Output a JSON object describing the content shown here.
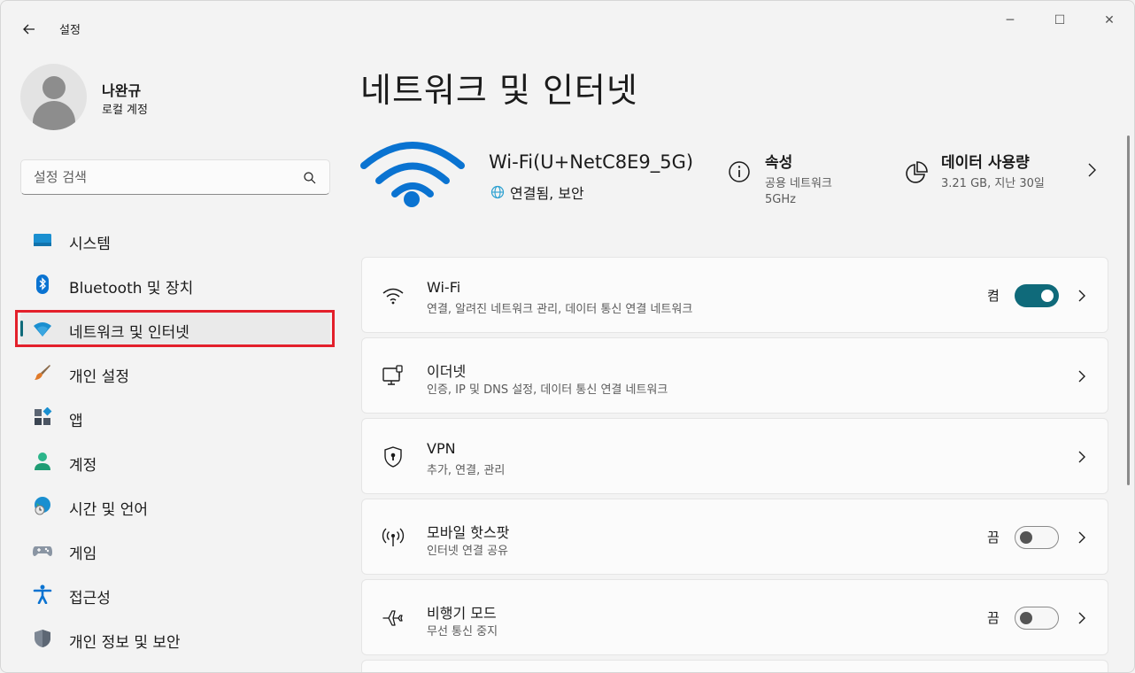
{
  "window": {
    "title": "설정",
    "controls": {
      "minimize": "─",
      "maximize": "☐",
      "close": "✕"
    }
  },
  "profile": {
    "name": "나완규",
    "account_type": "로컬 계정"
  },
  "search": {
    "placeholder": "설정 검색"
  },
  "sidebar": {
    "items": [
      {
        "label": "시스템",
        "icon": "system-icon"
      },
      {
        "label": "Bluetooth 및 장치",
        "icon": "bluetooth-icon"
      },
      {
        "label": "네트워크 및 인터넷",
        "icon": "wifi-icon",
        "active": true
      },
      {
        "label": "개인 설정",
        "icon": "brush-icon"
      },
      {
        "label": "앱",
        "icon": "apps-icon"
      },
      {
        "label": "계정",
        "icon": "account-icon"
      },
      {
        "label": "시간 및 언어",
        "icon": "globe-clock-icon"
      },
      {
        "label": "게임",
        "icon": "gamepad-icon"
      },
      {
        "label": "접근성",
        "icon": "accessibility-icon"
      },
      {
        "label": "개인 정보 및 보안",
        "icon": "shield-icon"
      }
    ]
  },
  "main": {
    "title": "네트워크 및 인터넷",
    "connection": {
      "name": "Wi-Fi(U+NetC8E9_5G)",
      "status": "연결됨, 보안",
      "properties_title": "속성",
      "properties_line1": "공용 네트워크",
      "properties_line2": "5GHz",
      "data_usage_title": "데이터 사용량",
      "data_usage_sub": "3.21 GB, 지난 30일"
    },
    "cards": [
      {
        "title": "Wi-Fi",
        "subtitle": "연결, 알려진 네트워크 관리, 데이터 통신 연결 네트워크",
        "state": "켬",
        "toggle_on": true,
        "icon": "wifi-icon"
      },
      {
        "title": "이더넷",
        "subtitle": "인증, IP 및 DNS 설정, 데이터 통신 연결 네트워크",
        "icon": "ethernet-icon"
      },
      {
        "title": "VPN",
        "subtitle": "추가, 연결, 관리",
        "icon": "vpn-shield-icon"
      },
      {
        "title": "모바일 핫스팟",
        "subtitle": "인터넷 연결 공유",
        "state": "끔",
        "toggle_on": false,
        "icon": "hotspot-icon"
      },
      {
        "title": "비행기 모드",
        "subtitle": "무선 통신 중지",
        "state": "끔",
        "toggle_on": false,
        "icon": "airplane-icon"
      }
    ]
  },
  "colors": {
    "accent": "#0f6a7a",
    "highlight_box": "#e3202b",
    "background": "#f3f3f3",
    "card": "#fbfbfb"
  }
}
